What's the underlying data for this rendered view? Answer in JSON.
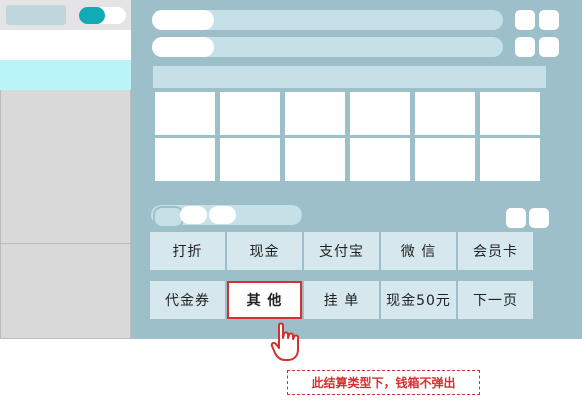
{
  "payment_buttons": {
    "row1": [
      "打折",
      "现金",
      "支付宝",
      "微 信",
      "会员卡"
    ],
    "row2": [
      "代金券",
      "其 他",
      "挂 单",
      "现金50元",
      "下一页"
    ]
  },
  "selected_button": "其 他",
  "annotation": {
    "text": "此结算类型下，钱箱不弹出"
  },
  "icons": {
    "pointer": "hand-pointer-icon"
  },
  "colors": {
    "accent": "#12aab6",
    "highlight": "#d33131",
    "panel": "#9cbfca",
    "selected_row": "#b8f4f8"
  }
}
